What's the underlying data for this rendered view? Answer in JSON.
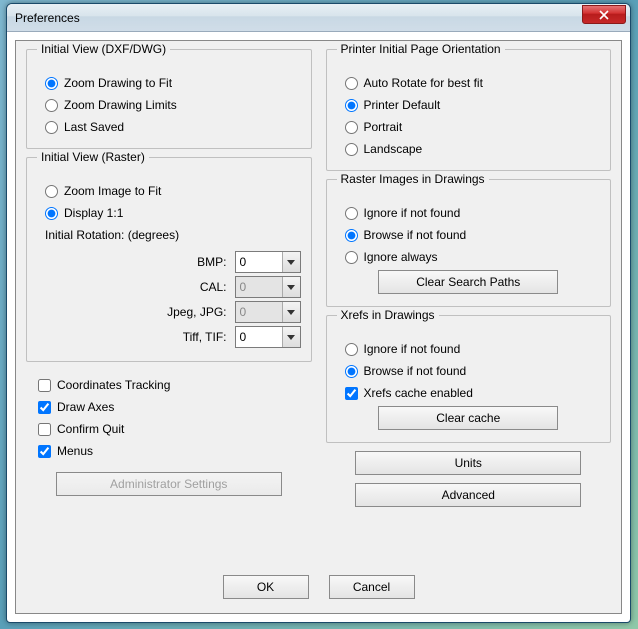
{
  "window": {
    "title": "Preferences"
  },
  "initialViewDxf": {
    "legend": "Initial View (DXF/DWG)",
    "options": [
      "Zoom Drawing to Fit",
      "Zoom Drawing Limits",
      "Last Saved"
    ],
    "selected": 0
  },
  "initialViewRaster": {
    "legend": "Initial View (Raster)",
    "options": [
      "Zoom Image to Fit",
      "Display 1:1"
    ],
    "selected": 1,
    "rotationLabel": "Initial Rotation: (degrees)",
    "rows": [
      {
        "label": "BMP:",
        "value": "0",
        "enabled": true
      },
      {
        "label": "CAL:",
        "value": "0",
        "enabled": false
      },
      {
        "label": "Jpeg, JPG:",
        "value": "0",
        "enabled": false
      },
      {
        "label": "Tiff, TIF:",
        "value": "0",
        "enabled": true
      }
    ]
  },
  "checkboxes": [
    {
      "label": "Coordinates Tracking",
      "checked": false
    },
    {
      "label": "Draw Axes",
      "checked": true
    },
    {
      "label": "Confirm Quit",
      "checked": false
    },
    {
      "label": "Menus",
      "checked": true
    }
  ],
  "adminBtn": "Administrator Settings",
  "printerOrientation": {
    "legend": "Printer Initial Page Orientation",
    "options": [
      "Auto Rotate for best fit",
      "Printer Default",
      "Portrait",
      "Landscape"
    ],
    "selected": 1
  },
  "rasterImages": {
    "legend": "Raster Images in Drawings",
    "options": [
      "Ignore if not found",
      "Browse if not found",
      "Ignore always"
    ],
    "selected": 1,
    "clearBtn": "Clear Search Paths"
  },
  "xrefs": {
    "legend": "Xrefs in Drawings",
    "options": [
      "Ignore if not found",
      "Browse if not found"
    ],
    "selected": 1,
    "cacheCheck": {
      "label": "Xrefs cache enabled",
      "checked": true
    },
    "clearBtn": "Clear cache"
  },
  "unitsBtn": "Units",
  "advancedBtn": "Advanced",
  "okBtn": "OK",
  "cancelBtn": "Cancel"
}
